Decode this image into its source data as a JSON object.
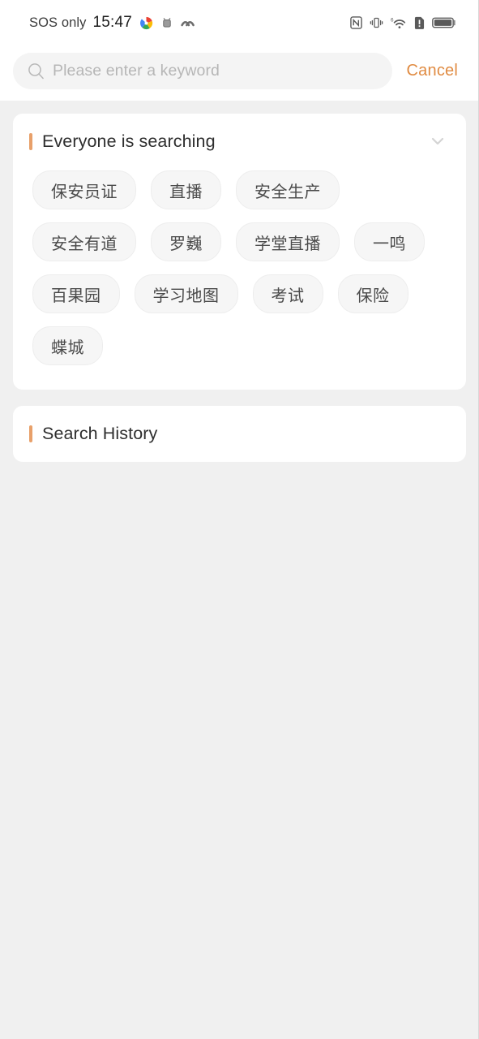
{
  "status_bar": {
    "carrier": "SOS only",
    "time": "15:47",
    "left_icons": [
      "color-flower-app-icon",
      "android-app-icon",
      "waves-app-icon"
    ],
    "right_icons": [
      "nfc-icon",
      "vibrate-icon",
      "wifi-6-icon",
      "sim-alert-icon",
      "battery-icon"
    ]
  },
  "search": {
    "placeholder": "Please enter a keyword",
    "value": "",
    "icon": "search-icon",
    "cancel_label": "Cancel",
    "cancel_color": "#e08b42"
  },
  "hot_search": {
    "title": "Everyone is searching",
    "accent_color": "#e8a06a",
    "collapse_icon": "chevron-down-icon",
    "tags": [
      "保安员证",
      "直播",
      "安全生产",
      "安全有道",
      "罗巍",
      "学堂直播",
      "一鸣",
      "百果园",
      "学习地图",
      "考试",
      "保险",
      "蝶城"
    ]
  },
  "history": {
    "title": "Search History",
    "accent_color": "#e8a06a",
    "items": []
  }
}
